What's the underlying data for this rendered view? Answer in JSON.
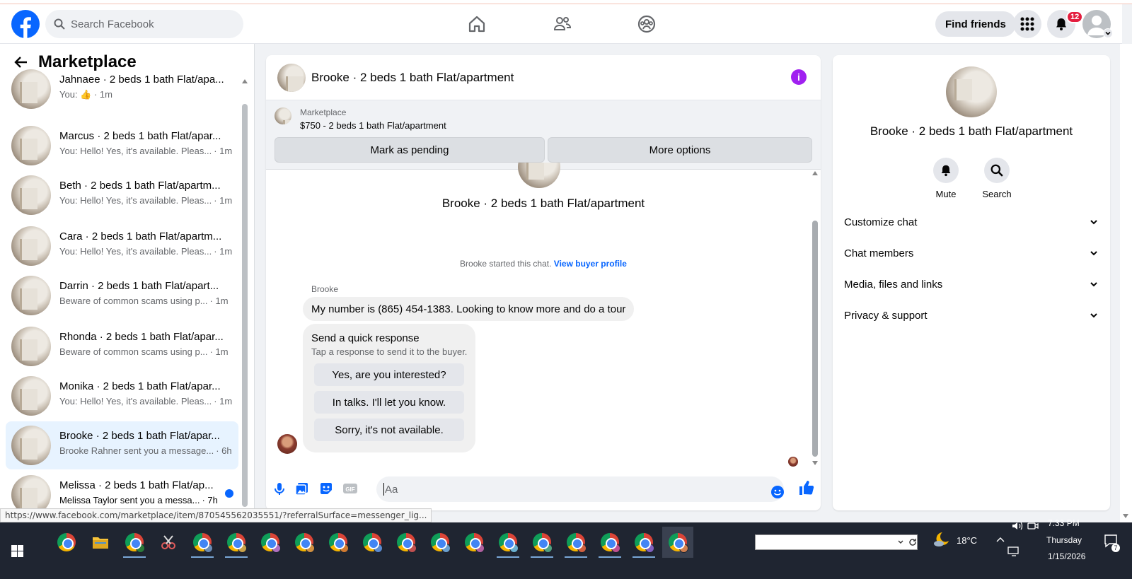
{
  "topbar": {
    "search_placeholder": "Search Facebook",
    "find_friends": "Find friends",
    "notif_count": "12"
  },
  "sidebar": {
    "title": "Marketplace",
    "conversations": [
      {
        "title": "Jahnaee · 2 beds 1 bath Flat/apa...",
        "preview": "You: 👍 · 1m",
        "active": false
      },
      {
        "title": "Marcus · 2 beds 1 bath Flat/apar...",
        "preview": "You: Hello! Yes, it's available. Pleas...",
        "time": "· 1m"
      },
      {
        "title": "Beth · 2 beds 1 bath Flat/apartm...",
        "preview": "You: Hello! Yes, it's available. Pleas...",
        "time": "· 1m"
      },
      {
        "title": "Cara · 2 beds 1 bath Flat/apartm...",
        "preview": "You: Hello! Yes, it's available. Pleas...",
        "time": "· 1m"
      },
      {
        "title": "Darrin · 2 beds 1 bath Flat/apart...",
        "preview": "Beware of common scams using p...",
        "time": "· 1m"
      },
      {
        "title": "Rhonda · 2 beds 1 bath Flat/apar...",
        "preview": "Beware of common scams using p...",
        "time": "· 1m"
      },
      {
        "title": "Monika · 2 beds 1 bath Flat/apar...",
        "preview": "You: Hello! Yes, it's available. Pleas...",
        "time": "· 1m"
      },
      {
        "title": "Brooke · 2 beds 1 bath Flat/apar...",
        "preview": "Brooke Rahner sent you a message...",
        "time": "· 6h"
      },
      {
        "title": "Melissa · 2 beds 1 bath Flat/ap...",
        "preview": "Melissa Taylor sent you a messa...",
        "time": "· 7h"
      }
    ]
  },
  "chat": {
    "header_title": "Brooke · 2 beds 1 bath Flat/apartment",
    "marketplace_label": "Marketplace",
    "listing": "$750 - 2 beds 1 bath Flat/apartment",
    "mark_pending": "Mark as pending",
    "more_options": "More options",
    "body_title": "Brooke · 2 beds 1 bath Flat/apartment",
    "started_text": "Brooke started this chat.",
    "view_buyer_profile": "View buyer profile",
    "sender_name": "Brooke",
    "message": "My number is (865) 454-1383. Looking to know more and do a tour",
    "quick_response": {
      "heading": "Send a quick response",
      "subtext": "Tap a response to send it to the buyer.",
      "options": [
        "Yes, are you interested?",
        "In talks. I'll let you know.",
        "Sorry, it's not available."
      ]
    },
    "input_placeholder": "Aa"
  },
  "details": {
    "title": "Brooke · 2 beds 1 bath Flat/apartment",
    "mute": "Mute",
    "search": "Search",
    "sections": [
      "Customize chat",
      "Chat members",
      "Media, files and links",
      "Privacy & support"
    ]
  },
  "status_url": "https://www.facebook.com/marketplace/item/870545562035551/?referralSurface=messenger_lig...",
  "taskbar": {
    "temperature": "18°C",
    "time": "7:33 PM",
    "day": "Thursday",
    "date": "1/15/2026",
    "notification_count": "7"
  },
  "colors": {
    "brand": "#0866ff",
    "info_purple": "#a020f0",
    "badge_red": "#e41e3f"
  }
}
